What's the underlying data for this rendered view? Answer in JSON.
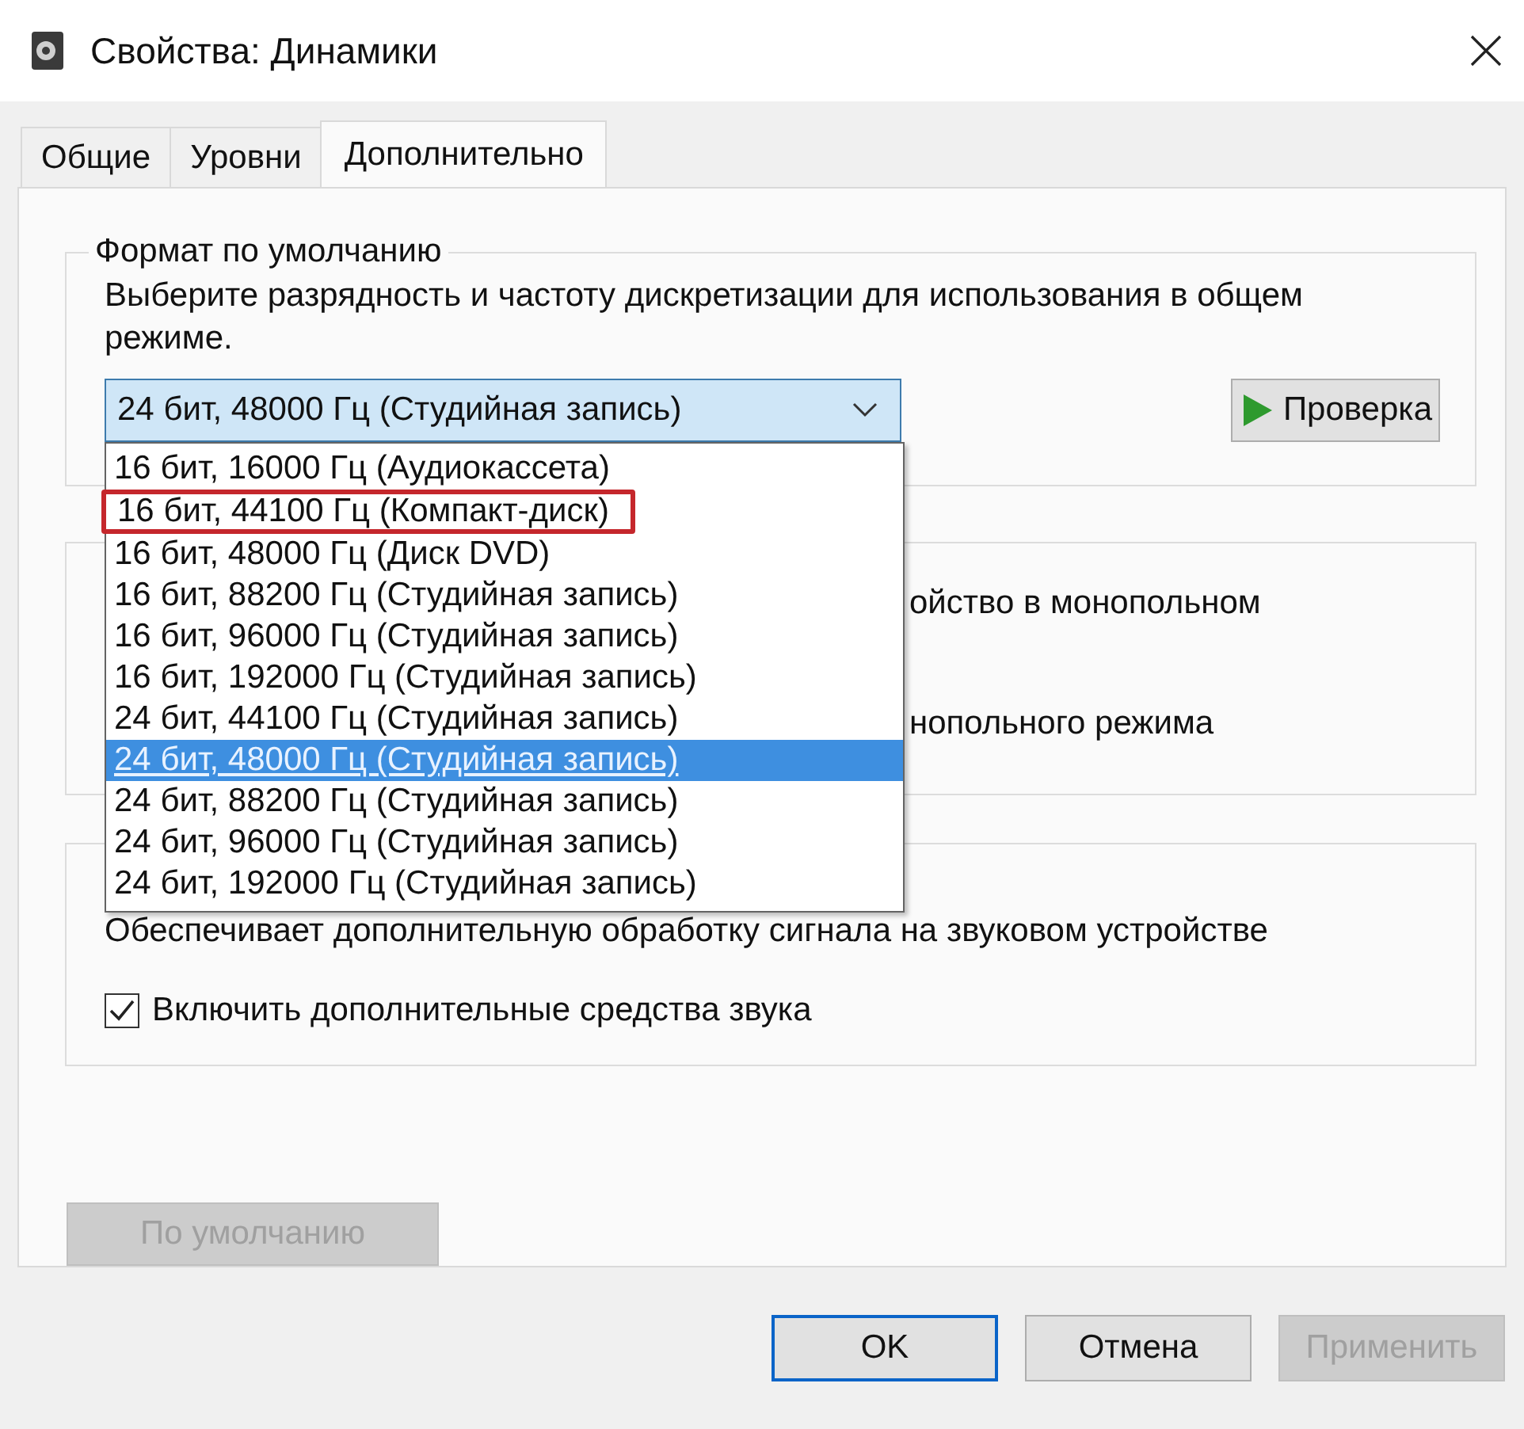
{
  "window": {
    "title": "Свойства: Динамики"
  },
  "tabs": [
    {
      "label": "Общие",
      "selected": false
    },
    {
      "label": "Уровни",
      "selected": false
    },
    {
      "label": "Дополнительно",
      "selected": true
    }
  ],
  "default_format": {
    "title": "Формат по умолчанию",
    "description": "Выберите разрядность и частоту дискретизации для использования в общем режиме.",
    "dropdown": {
      "value": "24 бит, 48000 Гц (Студийная запись)",
      "expanded": true,
      "options": [
        {
          "label": "16 бит, 16000 Гц (Аудиокассета)",
          "selected": false,
          "highlighted": false
        },
        {
          "label": "16 бит, 44100 Гц (Компакт-диск)",
          "selected": false,
          "highlighted": true
        },
        {
          "label": "16 бит, 48000 Гц (Диск DVD)",
          "selected": false,
          "highlighted": false
        },
        {
          "label": "16 бит, 88200 Гц (Студийная запись)",
          "selected": false,
          "highlighted": false
        },
        {
          "label": "16 бит, 96000 Гц (Студийная запись)",
          "selected": false,
          "highlighted": false
        },
        {
          "label": "16 бит, 192000 Гц (Студийная запись)",
          "selected": false,
          "highlighted": false
        },
        {
          "label": "24 бит, 44100 Гц (Студийная запись)",
          "selected": false,
          "highlighted": false
        },
        {
          "label": "24 бит, 48000 Гц (Студийная запись)",
          "selected": true,
          "highlighted": false
        },
        {
          "label": "24 бит, 88200 Гц (Студийная запись)",
          "selected": false,
          "highlighted": false
        },
        {
          "label": "24 бит, 96000 Гц (Студийная запись)",
          "selected": false,
          "highlighted": false
        },
        {
          "label": "24 бит, 192000 Гц (Студийная запись)",
          "selected": false,
          "highlighted": false
        }
      ]
    },
    "test_button": "Проверка"
  },
  "exclusive_mode_group": {
    "lines": [
      "ойство в монопольном",
      "нопольного режима"
    ]
  },
  "enhancements_group": {
    "description": "Обеспечивает дополнительную обработку сигнала на звуковом устройстве",
    "checkbox": {
      "label": "Включить дополнительные средства звука",
      "checked": true
    }
  },
  "restore_defaults_button": {
    "label": "По умолчанию",
    "disabled": true
  },
  "buttons": [
    {
      "label": "OK",
      "kind": "default",
      "disabled": false
    },
    {
      "label": "Отмена",
      "kind": "normal",
      "disabled": false
    },
    {
      "label": "Применить",
      "kind": "normal",
      "disabled": true
    }
  ]
}
